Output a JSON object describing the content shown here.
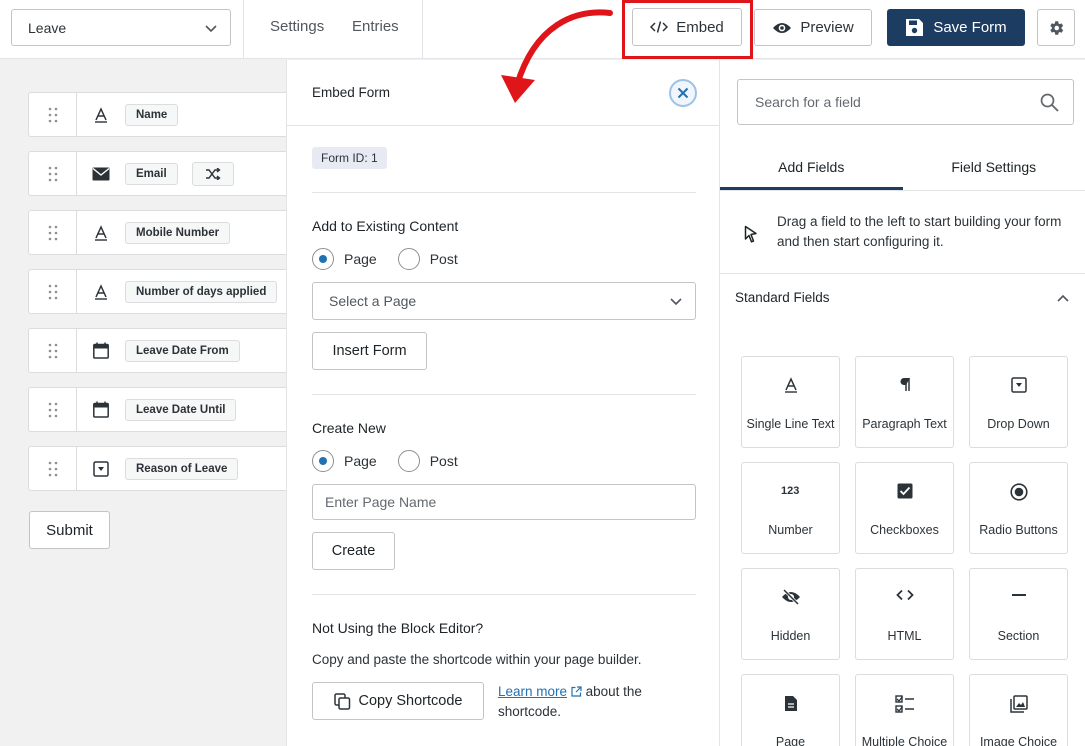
{
  "topbar": {
    "form_name": "Leave",
    "settings_label": "Settings",
    "entries_label": "Entries",
    "embed_label": "Embed",
    "preview_label": "Preview",
    "save_label": "Save Form"
  },
  "canvas": {
    "fields": [
      {
        "label": "Name",
        "icon": "text-icon"
      },
      {
        "label": "Email",
        "icon": "envelope-icon"
      },
      {
        "label": "Mobile Number",
        "icon": "text-icon"
      },
      {
        "label": "Number of days applied",
        "icon": "text-icon"
      },
      {
        "label": "Leave Date From",
        "icon": "calendar-icon"
      },
      {
        "label": "Leave Date Until",
        "icon": "calendar-icon"
      },
      {
        "label": "Reason of Leave",
        "icon": "dropdown-icon"
      }
    ],
    "submit_label": "Submit"
  },
  "embed": {
    "title": "Embed Form",
    "form_id": "Form ID: 1",
    "existing_title": "Add to Existing Content",
    "radio_page": "Page",
    "radio_post": "Post",
    "select_placeholder": "Select a Page",
    "insert_label": "Insert Form",
    "create_title": "Create New",
    "page_name_placeholder": "Enter Page Name",
    "create_label": "Create",
    "block_title": "Not Using the Block Editor?",
    "block_text": "Copy and paste the shortcode within your page builder.",
    "copy_label": "Copy Shortcode",
    "learn_more": "Learn more",
    "learn_rest": "about the shortcode."
  },
  "sidebar": {
    "search_placeholder": "Search for a field",
    "tab_add": "Add Fields",
    "tab_settings": "Field Settings",
    "hint": "Drag a field to the left to start building your form and then start configuring it.",
    "standard_fields": "Standard Fields",
    "tiles": [
      {
        "label": "Single Line Text",
        "icon": "text-icon"
      },
      {
        "label": "Paragraph Text",
        "icon": "paragraph-icon"
      },
      {
        "label": "Drop Down",
        "icon": "dropdown-icon"
      },
      {
        "label": "Number",
        "icon": "number-icon"
      },
      {
        "label": "Checkboxes",
        "icon": "checkbox-icon"
      },
      {
        "label": "Radio Buttons",
        "icon": "radio-icon"
      },
      {
        "label": "Hidden",
        "icon": "eye-slash-icon"
      },
      {
        "label": "HTML",
        "icon": "code-icon"
      },
      {
        "label": "Section",
        "icon": "minus-icon"
      },
      {
        "label": "Page",
        "icon": "file-icon"
      },
      {
        "label": "Multiple Choice",
        "icon": "list-check-icon"
      },
      {
        "label": "Image Choice",
        "icon": "image-icon"
      }
    ]
  },
  "colors": {
    "primary": "#1c3c61",
    "highlight": "#e0151a",
    "link": "#2271b1"
  }
}
